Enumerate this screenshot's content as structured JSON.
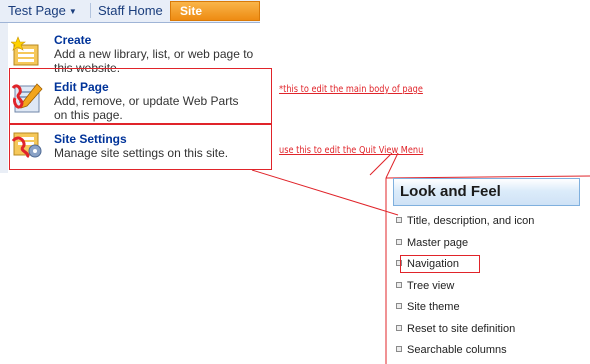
{
  "tabs": [
    {
      "label": "Test Page",
      "has_dropdown": true
    },
    {
      "label": "Staff Home",
      "has_dropdown": false
    }
  ],
  "site_actions": {
    "label": "Site Actions",
    "has_dropdown": true
  },
  "menu": {
    "items": [
      {
        "title": "Create",
        "description": "Add a new library, list, or web page to this website.",
        "icon": "create-icon"
      },
      {
        "title": "Edit Page",
        "description": "Add, remove, or update Web Parts on this page.",
        "icon": "edit-page-icon"
      },
      {
        "title": "Site Settings",
        "description": "Manage site settings on this site.",
        "icon": "site-settings-icon"
      }
    ]
  },
  "annotations": {
    "edit_note": "*this to edit the main body of page",
    "settings_note": "use this to edit the Quit View Menu"
  },
  "look_and_feel": {
    "title": "Look and Feel",
    "items": [
      "Title, description, and icon",
      "Master page",
      "Navigation",
      "Tree view",
      "Site theme",
      "Reset to site definition",
      "Searchable columns"
    ]
  },
  "colors": {
    "site_actions": "#ee8b12",
    "menu_title": "#003399",
    "annotation": "#e0242a"
  }
}
